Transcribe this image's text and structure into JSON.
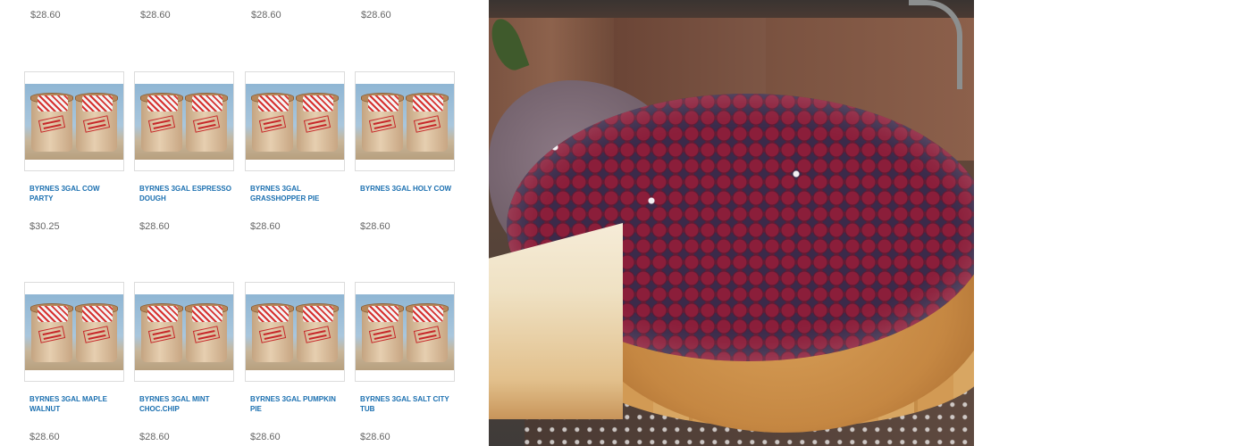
{
  "top_prices": [
    "$28.60",
    "$28.60",
    "$28.60",
    "$28.60"
  ],
  "products": [
    {
      "name": "BYRNES 3GAL COW PARTY",
      "price": "$30.25"
    },
    {
      "name": "BYRNES 3GAL ESPRESSO DOUGH",
      "price": "$28.60"
    },
    {
      "name": "BYRNES 3GAL GRASSHOPPER PIE",
      "price": "$28.60"
    },
    {
      "name": "BYRNES 3GAL HOLY COW",
      "price": "$28.60"
    },
    {
      "name": "BYRNES 3GAL MAPLE WALNUT",
      "price": "$28.60"
    },
    {
      "name": "BYRNES 3GAL MINT CHOC.CHIP",
      "price": "$28.60"
    },
    {
      "name": "BYRNES 3GAL PUMPKIN PIE",
      "price": "$28.60"
    },
    {
      "name": "BYRNES 3GAL SALT CITY TUB",
      "price": "$28.60"
    }
  ],
  "colors": {
    "link": "#1a6fb0",
    "price": "#666666",
    "border": "#dcdcdc"
  }
}
